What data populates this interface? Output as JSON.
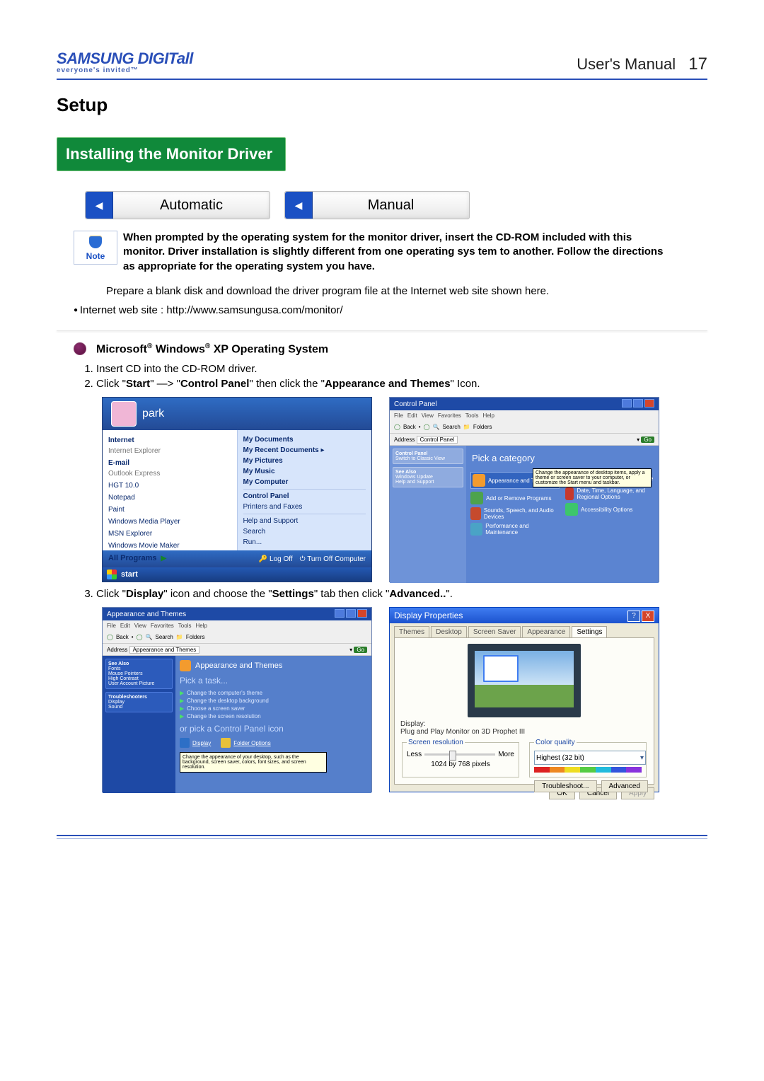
{
  "header": {
    "brand1": "SAMSUNG",
    "brand2": "DIGITall",
    "tagline": "everyone's invited™",
    "manual": "User's  Manual",
    "page": "17"
  },
  "section_title": "Setup",
  "green_banner": "Installing the Monitor Driver",
  "tabs": {
    "auto": "Automatic",
    "manual": "Manual"
  },
  "note": {
    "badge": "Note",
    "text": "When prompted by the operating system for the monitor driver, insert the CD-ROM included with this monitor. Driver installation is slightly different from one operating sys tem to another. Follow the directions as appropriate for the operating system you have."
  },
  "prepare": "Prepare a blank disk and download the driver program file at the Internet web site shown here.",
  "bullet": "Internet web site : http://www.samsungusa.com/monitor/",
  "os_heading": {
    "prefix": "Microsoft",
    "mid": " Windows",
    "suffix": " XP Operating System"
  },
  "steps": {
    "s1": "Insert CD into the CD-ROM driver.",
    "s2a": "Click \"",
    "s2b": "Start",
    "s2c": "\"  —> \"",
    "s2d": "Control Panel",
    "s2e": "\" then click the \"",
    "s2f": "Appearance and Themes",
    "s2g": "\" Icon.",
    "s3a": "Click \"",
    "s3b": "Display",
    "s3c": "\" icon and choose the \"",
    "s3d": "Settings",
    "s3e": "\" tab then click \"",
    "s3f": "Advanced..",
    "s3g": "\"."
  },
  "startmenu": {
    "user": "park",
    "left": {
      "ie_t": "Internet",
      "ie_s": "Internet Explorer",
      "em_t": "E-mail",
      "em_s": "Outlook Express",
      "i3": "HGT 10.0",
      "i4": "Notepad",
      "i5": "Paint",
      "i6": "Windows Media Player",
      "i7": "MSN Explorer",
      "i8": "Windows Movie Maker",
      "all": "All Programs"
    },
    "right": {
      "r1": "My Documents",
      "r2": "My Recent Documents",
      "r3": "My Pictures",
      "r4": "My Music",
      "r5": "My Computer",
      "r6": "Control Panel",
      "r7": "Printers and Faxes",
      "r8": "Help and Support",
      "r9": "Search",
      "r10": "Run..."
    },
    "footer": {
      "logoff": "Log Off",
      "turnoff": "Turn Off Computer"
    },
    "start": "start"
  },
  "cpanel": {
    "title": "Control Panel",
    "menu": [
      "File",
      "Edit",
      "View",
      "Favorites",
      "Tools",
      "Help"
    ],
    "tool": [
      "Back",
      "Search",
      "Folders"
    ],
    "addr_label": "Address",
    "addr_value": "Control Panel",
    "go": "Go",
    "side_title": "Control Panel",
    "side_switch": "Switch to Classic View",
    "see_also": "See Also",
    "see1": "Windows Update",
    "see2": "Help and Support",
    "pick": "Pick a category",
    "cats": {
      "c1": "Appearance and Themes",
      "c2": "Printers and Other Hardware",
      "c3": "Add or Remove Programs",
      "c4": "Date, Time, Language, and Regional Options",
      "c5": "Sounds, Speech, and Audio Devices",
      "c6": "Accessibility Options",
      "c7": "Performance and Maintenance"
    },
    "tip": "Change the appearance of desktop items, apply a theme or screen saver to your computer, or customize the Start menu and taskbar."
  },
  "appthemes": {
    "title": "Appearance and Themes",
    "addr_value": "Appearance and Themes",
    "see_also": "See Also",
    "sa1": "Fonts",
    "sa2": "Mouse Pointers",
    "sa3": "High Contrast",
    "sa4": "User Account Picture",
    "troubleshoot": "Troubleshooters",
    "ts1": "Display",
    "ts2": "Sound",
    "head": "Appearance and Themes",
    "pick_task": "Pick a task...",
    "t1": "Change the computer's theme",
    "t2": "Change the desktop background",
    "t3": "Choose a screen saver",
    "t4": "Change the screen resolution",
    "or_pick": "or pick a Control Panel icon",
    "ic1": "Display",
    "ic2": "Folder Options",
    "note": "Change the appearance of your desktop, such as the background, screen saver, colors, font sizes, and screen resolution."
  },
  "dispprop": {
    "title": "Display Properties",
    "tabs": {
      "themes": "Themes",
      "desktop": "Desktop",
      "ss": "Screen Saver",
      "appearance": "Appearance",
      "settings": "Settings"
    },
    "display_lbl": "Display:",
    "display_val": "Plug and Play Monitor on 3D Prophet III",
    "res_group": "Screen resolution",
    "less": "Less",
    "more": "More",
    "res_value": "1024 by 768 pixels",
    "cq_group": "Color quality",
    "cq_value": "Highest (32 bit)",
    "btn_tshoot": "Troubleshoot...",
    "btn_adv": "Advanced",
    "btn_ok": "OK",
    "btn_cancel": "Cancel",
    "btn_apply": "Apply"
  }
}
